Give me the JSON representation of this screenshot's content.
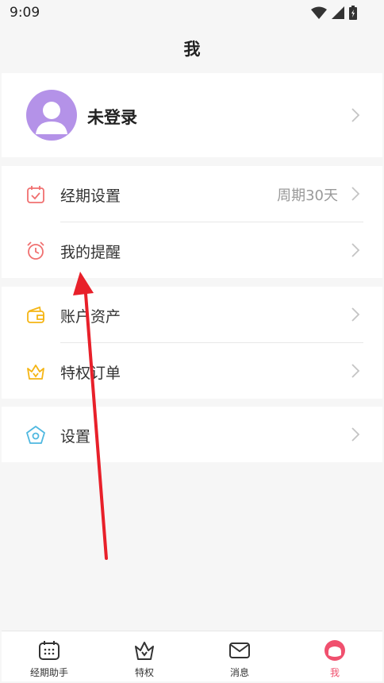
{
  "status_bar": {
    "time": "9:09"
  },
  "header": {
    "title": "我"
  },
  "profile": {
    "name": "未登录"
  },
  "menu_group_1": [
    {
      "label": "经期设置",
      "value": "周期30天",
      "icon": "calendar-check-icon"
    },
    {
      "label": "我的提醒",
      "value": "",
      "icon": "alarm-clock-icon"
    }
  ],
  "menu_group_2": [
    {
      "label": "账户资产",
      "icon": "wallet-icon"
    },
    {
      "label": "特权订单",
      "icon": "crown-icon"
    }
  ],
  "menu_group_3": [
    {
      "label": "设置",
      "icon": "pentagon-settings-icon"
    }
  ],
  "tabs": [
    {
      "label": "经期助手",
      "icon": "calendar-icon"
    },
    {
      "label": "特权",
      "icon": "crown-icon"
    },
    {
      "label": "消息",
      "icon": "mail-icon"
    },
    {
      "label": "我",
      "icon": "profile-icon",
      "active": true
    }
  ],
  "colors": {
    "accent": "#f0506e",
    "avatar": "#b492e8",
    "cycle_icon": "#f07070",
    "asset_icon": "#f5b514",
    "settings_icon": "#4fb8e0",
    "annotation_arrow": "#e8202a"
  }
}
